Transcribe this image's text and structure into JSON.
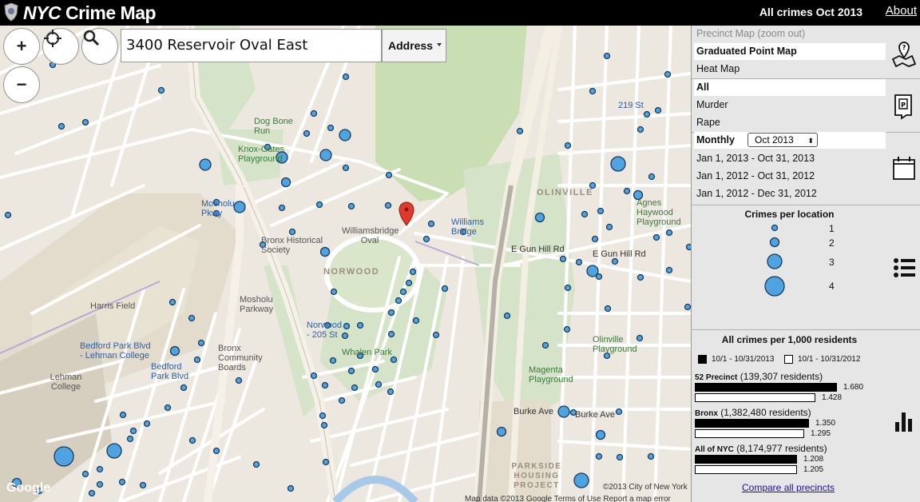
{
  "header": {
    "brand_nyc": "NYC",
    "brand_rest": "Crime Map",
    "subtitle": "All crimes Oct 2013",
    "about": "About"
  },
  "controls": {
    "zoom_in": "+",
    "zoom_out": "−",
    "search_value": "3400 Reservoir Oval East",
    "search_type": "Address"
  },
  "map": {
    "labels": [
      {
        "text": "Dog Bone Run",
        "cls": "green"
      },
      {
        "text": "Knox-Gates Playground",
        "cls": "green"
      },
      {
        "text": "Mosholu Pkwy",
        "cls": "blue"
      },
      {
        "text": "Bronx Historical Society",
        "cls": ""
      },
      {
        "text": "Williamsbridge Oval",
        "cls": ""
      },
      {
        "text": "NORWOOD",
        "cls": "big"
      },
      {
        "text": "Williams Bridge",
        "cls": "blue"
      },
      {
        "text": "E Gun Hill Rd",
        "cls": "road"
      },
      {
        "text": "OLINVILLE",
        "cls": "big"
      },
      {
        "text": "Agnes Haywood Playground",
        "cls": "green"
      },
      {
        "text": "219 St",
        "cls": "blue"
      },
      {
        "text": "Harris Field",
        "cls": ""
      },
      {
        "text": "Bedford Park Blvd - Lehman College",
        "cls": "blue"
      },
      {
        "text": "Lehman College",
        "cls": ""
      },
      {
        "text": "Bedford Park Blvd",
        "cls": "blue"
      },
      {
        "text": "Bronx Community Boards",
        "cls": ""
      },
      {
        "text": "Mosholu Parkway",
        "cls": ""
      },
      {
        "text": "Norwood - 205 St",
        "cls": "blue"
      },
      {
        "text": "Whalen Park",
        "cls": "green"
      },
      {
        "text": "Magenta Playground",
        "cls": "green"
      },
      {
        "text": "Olinville Playground",
        "cls": "green"
      },
      {
        "text": "E Gun Hill Rd",
        "cls": "road"
      },
      {
        "text": "Burke Ave",
        "cls": "road"
      },
      {
        "text": "Burke Ave",
        "cls": "road"
      },
      {
        "text": "PARKSIDE HOUSING PROJECT",
        "cls": "big"
      },
      {
        "text": "©2013 City of New York",
        "cls": "road"
      },
      {
        "text": "Map data ©2013 Google   Terms of Use   Report a map error",
        "cls": "road"
      },
      {
        "text": "Google",
        "cls": "white"
      }
    ]
  },
  "sidebar": {
    "map_types": [
      {
        "label": "Precinct Map (zoom out)",
        "state": "disabled"
      },
      {
        "label": "Graduated Point Map",
        "state": "sel"
      },
      {
        "label": "Heat Map",
        "state": ""
      }
    ],
    "crime_types": [
      {
        "label": "All",
        "state": "sel"
      },
      {
        "label": "Murder",
        "state": ""
      },
      {
        "label": "Rape",
        "state": ""
      }
    ],
    "period": {
      "mode_label": "Monthly",
      "selected_month": "Oct 2013",
      "ranges": [
        "Jan 1, 2013 - Oct 31, 2013",
        "Jan 1, 2012 - Oct 31, 2012",
        "Jan 1, 2012 - Dec 31, 2012"
      ]
    },
    "legend": {
      "title": "Crimes per location",
      "counts": [
        "1",
        "2",
        "3",
        "4"
      ]
    },
    "rates": {
      "title": "All crimes per 1,000 residents",
      "key_current": "10/1 - 10/31/2013",
      "key_previous": "10/1 - 10/31/2012",
      "areas": [
        {
          "name": "52 Precinct",
          "residents": "(139,307 residents)",
          "current": 1.68,
          "previous": 1.428,
          "current_label": "1.680",
          "previous_label": "1.428"
        },
        {
          "name": "Bronx",
          "residents": "(1,382,480 residents)",
          "current": 1.35,
          "previous": 1.295,
          "current_label": "1.350",
          "previous_label": "1.295"
        },
        {
          "name": "All of NYC",
          "residents": "(8,174,977 residents)",
          "current": 1.208,
          "previous": 1.205,
          "current_label": "1.208",
          "previous_label": "1.205"
        }
      ],
      "compare_link": "Compare all precincts"
    }
  },
  "colors": {
    "dot_fill": "#4fa3e0",
    "header_bg": "#000000",
    "park_green": "#c9dfb3",
    "sidebar_bg": "#e6e6e6"
  }
}
